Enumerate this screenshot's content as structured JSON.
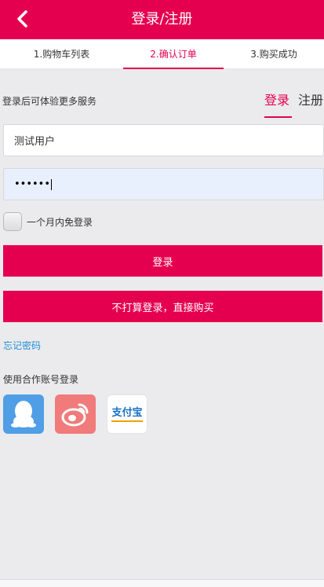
{
  "header": {
    "title": "登录/注册",
    "back_icon": "chevron-left-icon"
  },
  "steps": [
    {
      "label": "1.购物车列表",
      "active": false
    },
    {
      "label": "2.确认订单",
      "active": true
    },
    {
      "label": "3.购买成功",
      "active": false
    }
  ],
  "subhead": {
    "text": "登录后可体验更多服务",
    "tabs": [
      {
        "label": "登录",
        "active": true
      },
      {
        "label": "注册",
        "active": false
      }
    ]
  },
  "form": {
    "username_value": "测试用户",
    "password_value": "••••••",
    "remember_label": "一个月内免登录",
    "login_button": "登录",
    "guest_button": "不打算登录，直接购买",
    "forgot_link": "忘记密码"
  },
  "partners": {
    "title": "使用合作账号登录",
    "items": [
      {
        "name": "qq",
        "icon": "qq-penguin-icon"
      },
      {
        "name": "weibo",
        "icon": "weibo-eye-icon"
      },
      {
        "name": "alipay",
        "icon": "alipay-logo",
        "label": "支付宝"
      }
    ]
  },
  "colors": {
    "brand": "#e5004f",
    "link": "#1e8fd7",
    "background": "#ebebed"
  }
}
